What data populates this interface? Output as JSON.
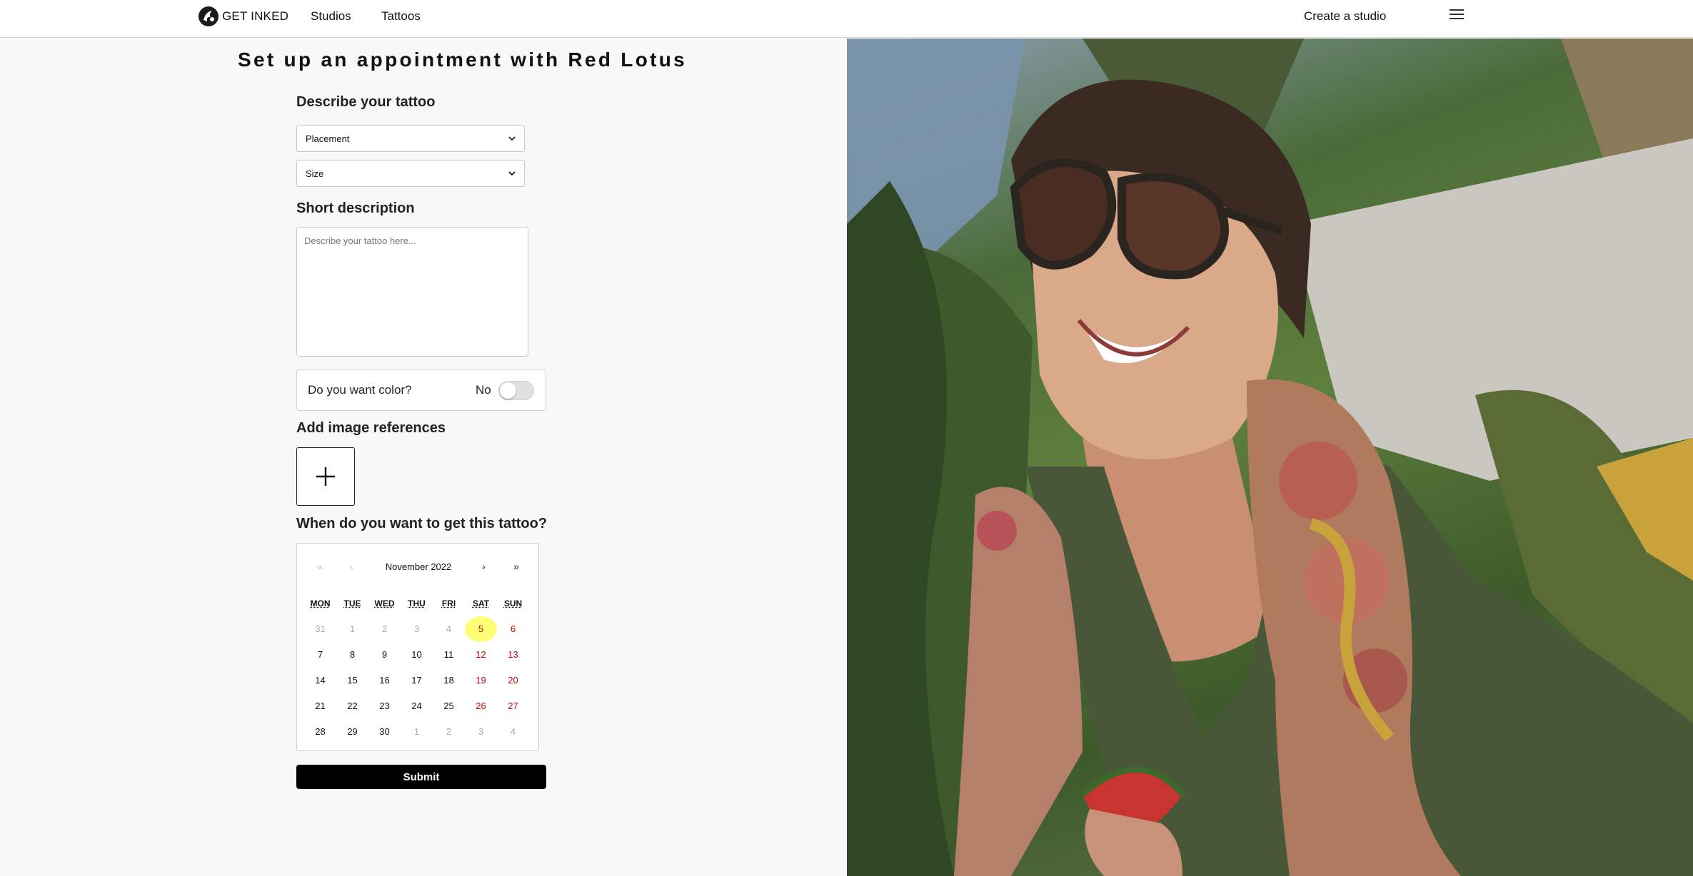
{
  "header": {
    "logo_text": "GET INKED",
    "nav": [
      "Studios",
      "Tattoos"
    ],
    "create_studio": "Create a studio",
    "menu_icon": "hamburger-menu-icon"
  },
  "form": {
    "title": "Set up an appointment with Red Lotus",
    "describe_title": "Describe your tattoo",
    "placement_value": "Placement",
    "size_value": "Size",
    "short_desc_title": "Short description",
    "short_desc_placeholder": "Describe your tattoo here...",
    "color_question": "Do you want color?",
    "color_state": "No",
    "image_refs_title": "Add image references",
    "when_title": "When do you want to get this tattoo?",
    "submit_label": "Submit"
  },
  "calendar": {
    "month_label": "November 2022",
    "nav": {
      "prev_year": "«",
      "prev_month": "‹",
      "next_month": "›",
      "next_year": "»"
    },
    "weekdays": [
      "MON",
      "TUE",
      "WED",
      "THU",
      "FRI",
      "SAT",
      "SUN"
    ],
    "weeks": [
      [
        "31",
        "1",
        "2",
        "3",
        "4",
        "5",
        "6"
      ],
      [
        "7",
        "8",
        "9",
        "10",
        "11",
        "12",
        "13"
      ],
      [
        "14",
        "15",
        "16",
        "17",
        "18",
        "19",
        "20"
      ],
      [
        "21",
        "22",
        "23",
        "24",
        "25",
        "26",
        "27"
      ],
      [
        "28",
        "29",
        "30",
        "1",
        "2",
        "3",
        "4"
      ]
    ],
    "highlighted_day": "5",
    "colors": {
      "weekend": "#d10000",
      "highlight": "#ffff76"
    }
  },
  "hero_image": {
    "subject": "smiling woman with tattooed arm and sunglasses holding watermelon"
  }
}
